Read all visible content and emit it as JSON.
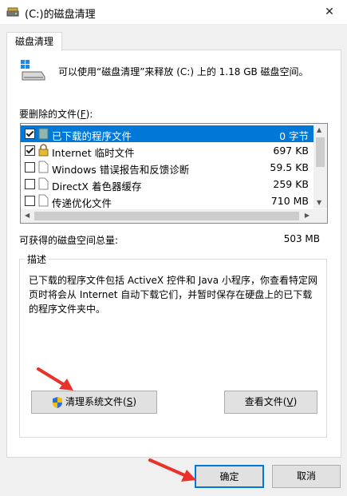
{
  "window": {
    "title": "(C:)的磁盘清理",
    "close_glyph": "✕"
  },
  "tab": {
    "label": "磁盘清理"
  },
  "info": {
    "text": "可以使用“磁盘清理”来释放  (C:) 上的 1.18 GB 磁盘空间。"
  },
  "files": {
    "label_prefix": "要删除的文件(",
    "label_key": "F",
    "label_suffix": "):",
    "items": [
      {
        "name": "已下载的程序文件",
        "size": "0 字节",
        "checked": true,
        "selected": true,
        "icon": "folder-icon"
      },
      {
        "name": "Internet 临时文件",
        "size": "697 KB",
        "checked": true,
        "selected": false,
        "icon": "lock-icon"
      },
      {
        "name": "Windows 错误报告和反馈诊断",
        "size": "59.5 KB",
        "checked": false,
        "selected": false,
        "icon": "file-icon"
      },
      {
        "name": "DirectX 着色器缓存",
        "size": "259 KB",
        "checked": false,
        "selected": false,
        "icon": "file-icon"
      },
      {
        "name": "传递优化文件",
        "size": "710 MB",
        "checked": false,
        "selected": false,
        "icon": "file-icon"
      }
    ]
  },
  "available": {
    "label": "可获得的磁盘空间总量:",
    "value": "503 MB"
  },
  "description": {
    "title": "描述",
    "text": "已下载的程序文件包括 ActiveX 控件和 Java 小程序，你查看特定网页时将会从 Internet 自动下载它们，并暂时保存在硬盘上的已下载的程序文件夹中。"
  },
  "buttons": {
    "clean_prefix": "清理系统文件(",
    "clean_key": "S",
    "clean_suffix": ")",
    "view_prefix": "查看文件(",
    "view_key": "V",
    "view_suffix": ")",
    "ok": "确定",
    "cancel": "取消"
  },
  "colors": {
    "selection": "#0078d7",
    "annotation_arrow": "#e8322a"
  }
}
